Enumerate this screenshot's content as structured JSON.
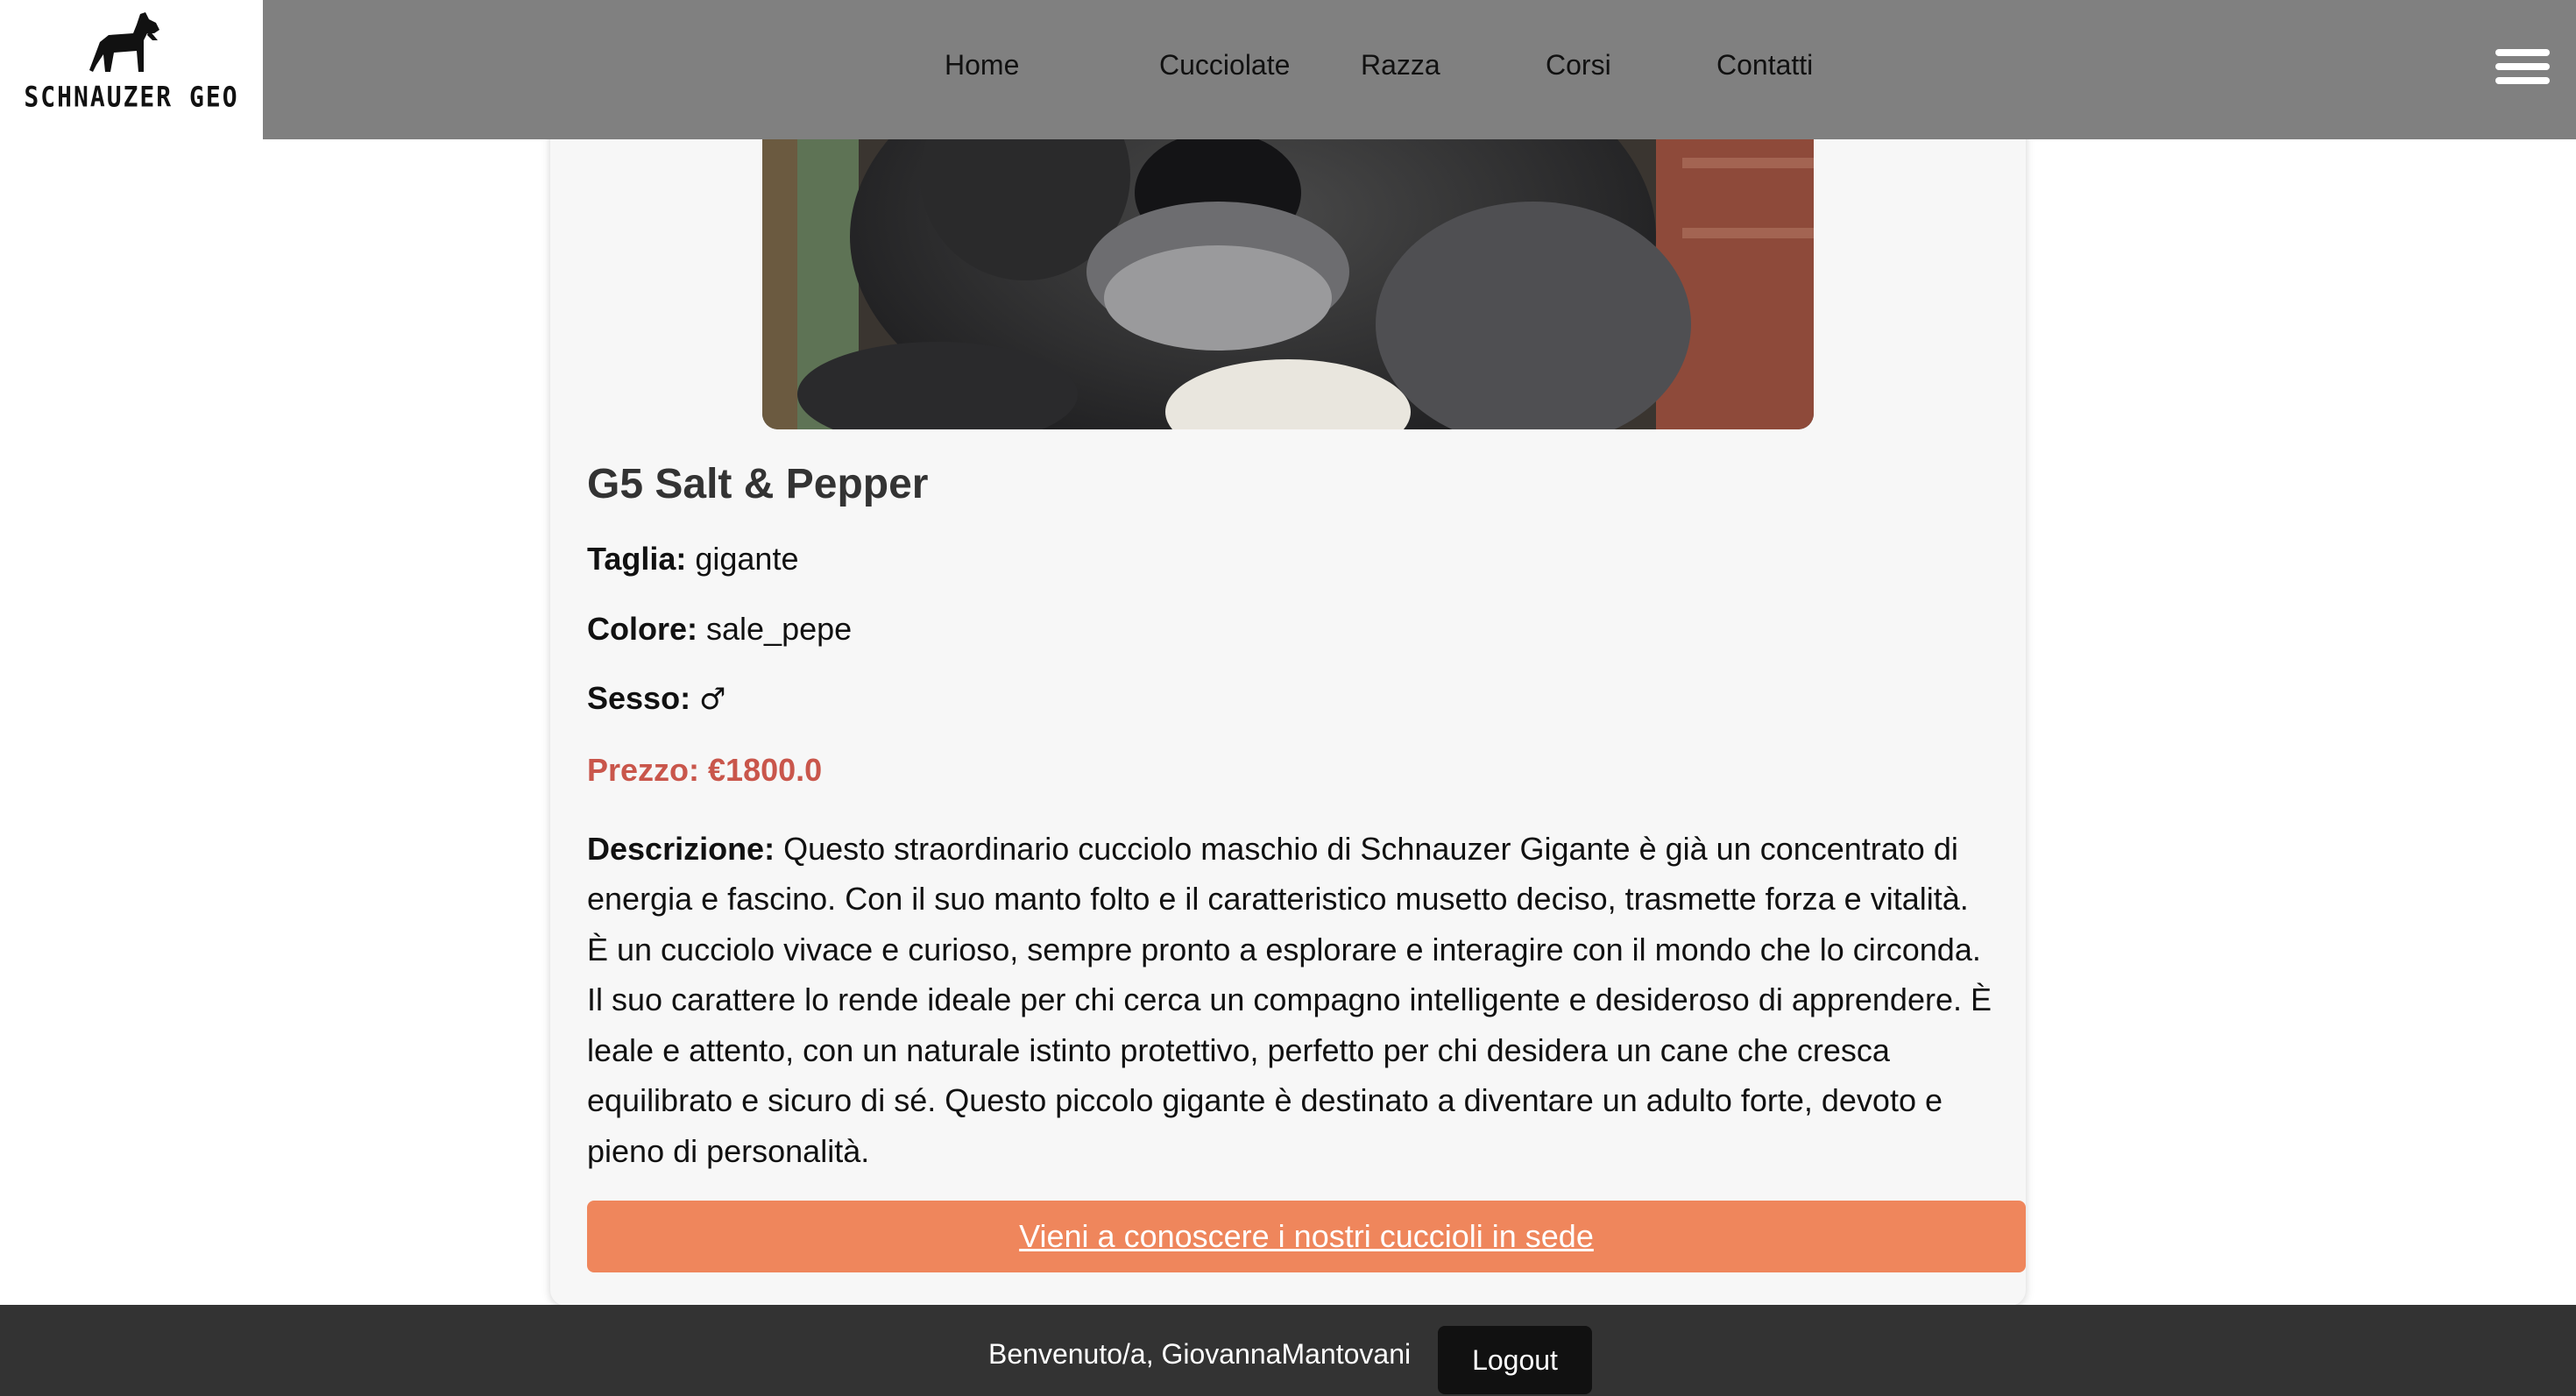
{
  "brand": {
    "name": "SCHNAUZER GEO",
    "icon": "schnauzer-dog-logo"
  },
  "nav": {
    "items": [
      {
        "label": "Home"
      },
      {
        "label": "Cucciolate"
      },
      {
        "label": "Razza"
      },
      {
        "label": "Corsi"
      },
      {
        "label": "Contatti"
      }
    ],
    "menu_icon": "hamburger-menu-icon"
  },
  "puppy": {
    "title": "G5 Salt & Pepper",
    "size_label": "Taglia:",
    "size_value": "gigante",
    "color_label": "Colore:",
    "color_value": "sale_pepe",
    "sex_label": "Sesso:",
    "sex_value": "♂",
    "price_text": "Prezzo: €1800.0",
    "description_label": "Descrizione:",
    "description_text": " Questo straordinario cucciolo maschio di Schnauzer Gigante è già un concentrato di energia e fascino. Con il suo manto folto e il caratteristico musetto deciso, trasmette forza e vitalità. È un cucciolo vivace e curioso, sempre pronto a esplorare e interagire con il mondo che lo circonda. Il suo carattere lo rende ideale per chi cerca un compagno intelligente e desideroso di apprendere. È leale e attento, con un naturale istinto protettivo, perfetto per chi desidera un cane che cresca equilibrato e sicuro di sé. Questo piccolo gigante è destinato a diventare un adulto forte, devoto e pieno di personalità."
  },
  "cta": {
    "label": "Vieni a conoscere i nostri cuccioli in sede"
  },
  "footer": {
    "welcome": "Benvenuto/a, GiovannaMantovani",
    "logout_label": "Logout"
  },
  "colors": {
    "header": "#808080",
    "price": "#c9564b",
    "cta": "#ef865c",
    "footer": "#333333"
  }
}
